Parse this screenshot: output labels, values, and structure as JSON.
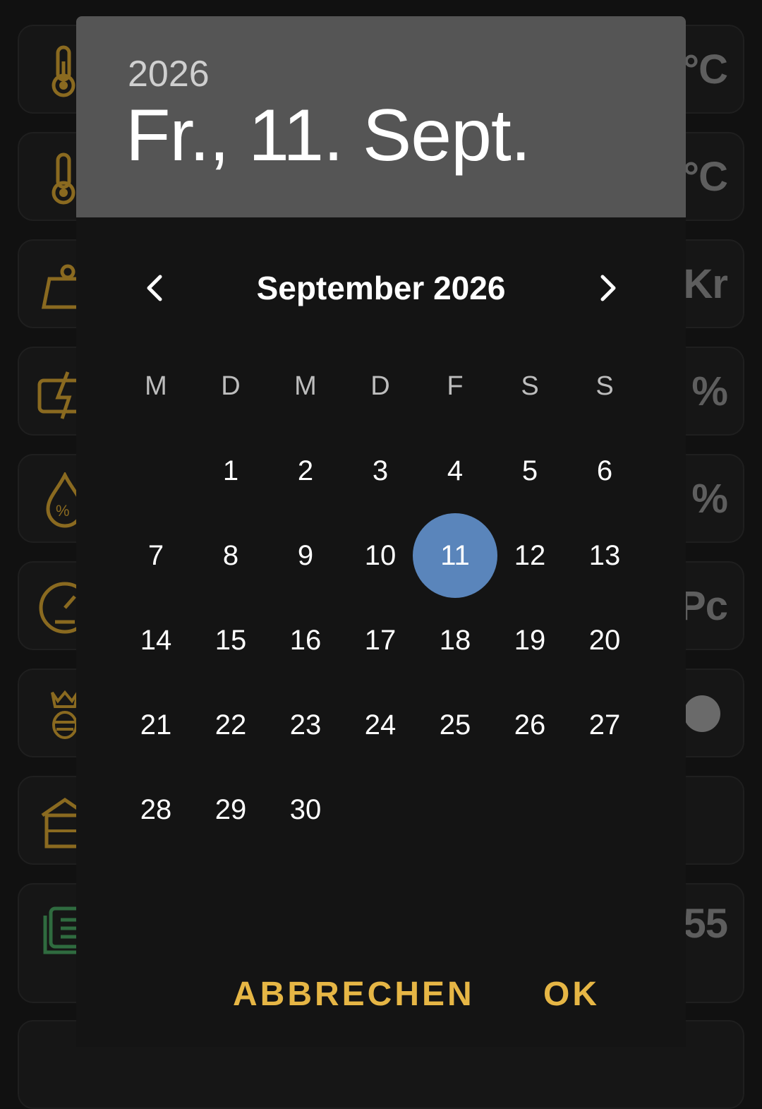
{
  "background_cards": [
    {
      "icon": "thermometer-icon",
      "unit": "°C",
      "icon_color": "#8a6a20"
    },
    {
      "icon": "thermometer-icon",
      "unit": "°C",
      "icon_color": "#8a6a20"
    },
    {
      "icon": "weight-kg-icon",
      "unit": "Kr",
      "icon_color": "#8a6a20"
    },
    {
      "icon": "battery-charge-icon",
      "unit": "%",
      "icon_color": "#8a6a20"
    },
    {
      "icon": "humidity-drop-icon",
      "unit": "%",
      "icon_color": "#8a6a20"
    },
    {
      "icon": "pressure-gauge-icon",
      "unit": "Pc",
      "icon_color": "#8a6a20"
    },
    {
      "icon": "queen-bee-icon",
      "unit": "",
      "icon_color": "#8a6a20"
    },
    {
      "icon": "beehive-icon",
      "unit": "",
      "icon_color": "#8a6a20"
    },
    {
      "icon": "frames-icon",
      "unit": "55",
      "icon_color": "#2f6b3f"
    }
  ],
  "dialog": {
    "header": {
      "year": "2026",
      "date": "Fr., 11. Sept."
    },
    "month_title": "September 2026",
    "weekdays": [
      "M",
      "D",
      "M",
      "D",
      "F",
      "S",
      "S"
    ],
    "weeks": [
      [
        "",
        "1",
        "2",
        "3",
        "4",
        "5",
        "6"
      ],
      [
        "7",
        "8",
        "9",
        "10",
        "11",
        "12",
        "13"
      ],
      [
        "14",
        "15",
        "16",
        "17",
        "18",
        "19",
        "20"
      ],
      [
        "21",
        "22",
        "23",
        "24",
        "25",
        "26",
        "27"
      ],
      [
        "28",
        "29",
        "30",
        "",
        "",
        "",
        ""
      ]
    ],
    "selected_day": "11",
    "cancel_label": "ABBRECHEN",
    "ok_label": "OK"
  },
  "colors": {
    "accent": "#e6b645",
    "selected": "#5a85bb",
    "header_bg": "#555555"
  }
}
